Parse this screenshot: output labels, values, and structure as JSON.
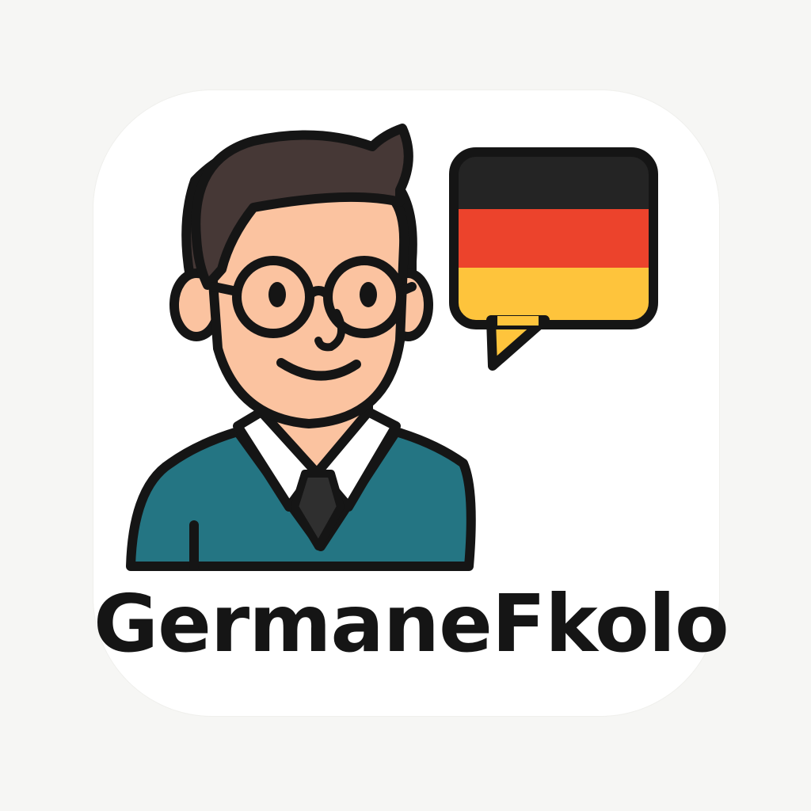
{
  "app": {
    "name": "GermaneFkolo"
  },
  "icons": {
    "mascot": "teacher-avatar-icon",
    "speech": "speech-bubble-icon",
    "flag": "german-flag-icon"
  },
  "colors": {
    "background": "#f6f6f4",
    "card": "#ffffff",
    "outline": "#151515",
    "hair": "#463836",
    "skin": "#fbc3a0",
    "sweater": "#247583",
    "shirt": "#ffffff",
    "tie": "#2f2f2f",
    "flag_black": "#242424",
    "flag_red": "#ec432c",
    "flag_gold": "#fec43c"
  }
}
